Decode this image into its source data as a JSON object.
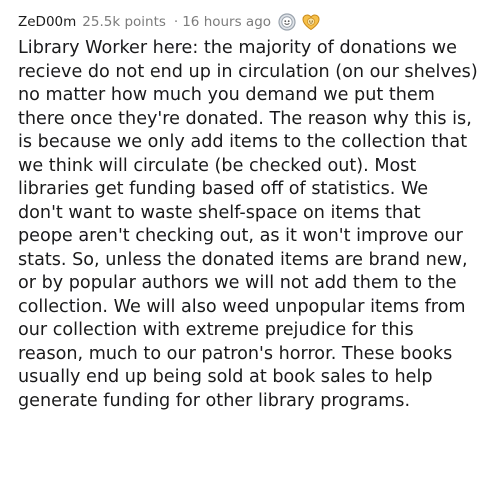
{
  "comment": {
    "username": "ZeD00m",
    "points": "25.5k points",
    "separator": "·",
    "time": "16 hours ago",
    "awards": [
      "silver-award-icon",
      "wholesome-award-icon"
    ],
    "body_lines": [
      "Library Worker here: the majority of donations we",
      "recieve do not end up in circulation (on our shelves)",
      "no matter how much you demand we put them",
      "there once they're donated. The reason why this is,",
      "is because we only add items to the collection that",
      "we think will circulate (be checked out). Most",
      "libraries get funding based off of statistics. We",
      "don't want to waste shelf-space on items that",
      "peope aren't checking out, as it won't improve our",
      "stats. So, unless the donated items are brand new,",
      "or by popular authors we will not add them to the",
      "collection. We will also weed unpopular items from",
      "our collection with extreme prejudice for this",
      "reason, much to our patron's horror. These books",
      "usually end up being sold at book sales to help",
      "generate funding for other library programs."
    ]
  }
}
